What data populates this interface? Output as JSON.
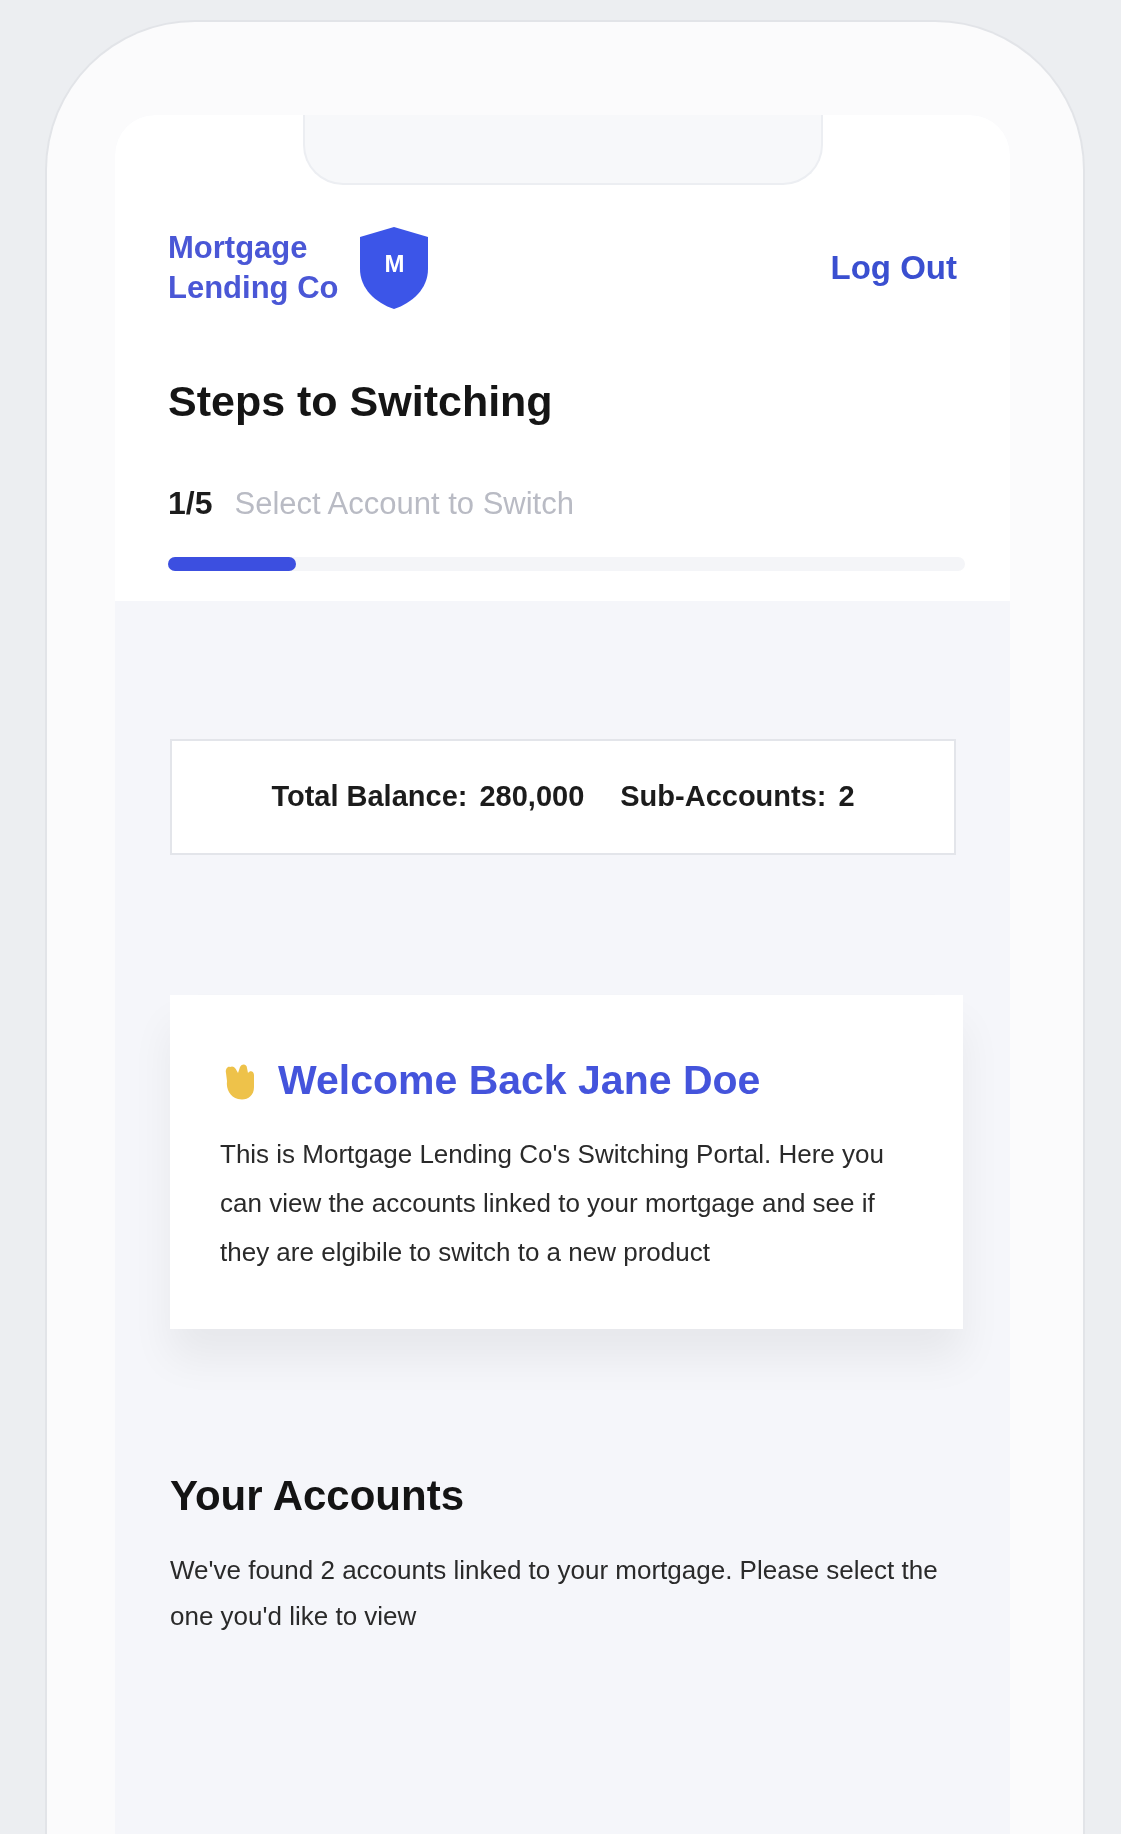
{
  "header": {
    "brand_lines": [
      "Mortgage",
      "Lending Co"
    ],
    "logo_letter": "M",
    "logout": "Log Out"
  },
  "steps": {
    "title": "Steps to Switching",
    "counter": "1/5",
    "step_label": "Select Account to Switch",
    "level": 0.16
  },
  "summary": {
    "items": [
      {
        "label": "Total Balance:",
        "value": "280,000"
      },
      {
        "label": "Sub-Accounts:",
        "value": "2"
      }
    ]
  },
  "welcome": {
    "title": "Welcome Back Jane Doe",
    "body": "This is Mortgage Lending Co's Switching Portal. Here you can view the accounts linked to your mortgage and see if they are elgibile to switch to a new product"
  },
  "accounts": {
    "title": "Your Accounts",
    "body": "We've found 2 accounts linked to your mortgage. Please select the one you'd like to view"
  }
}
